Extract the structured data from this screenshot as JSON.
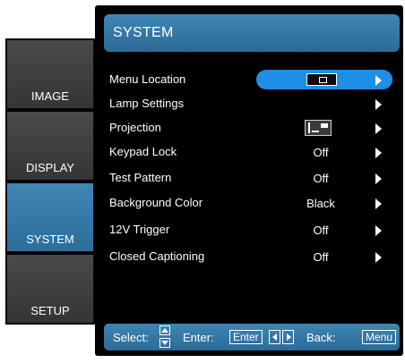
{
  "tabs": [
    {
      "label": "IMAGE",
      "active": false
    },
    {
      "label": "DISPLAY",
      "active": false
    },
    {
      "label": "SYSTEM",
      "active": true
    },
    {
      "label": "SETUP",
      "active": false
    }
  ],
  "title": "SYSTEM",
  "menu": [
    {
      "label": "Menu Location",
      "value": "",
      "icon": "menu-location-icon",
      "selected": true
    },
    {
      "label": "Lamp Settings",
      "value": ""
    },
    {
      "label": "Projection",
      "value": "",
      "icon": "projection-mode-icon"
    },
    {
      "label": "Keypad Lock",
      "value": "Off"
    },
    {
      "label": "Test Pattern",
      "value": "Off"
    },
    {
      "label": "Background Color",
      "value": "Black"
    },
    {
      "label": "12V Trigger",
      "value": "Off"
    },
    {
      "label": "Closed Captioning",
      "value": "Off"
    }
  ],
  "footer": {
    "select_label": "Select:",
    "enter_label": "Enter:",
    "enter_key": "Enter",
    "back_label": "Back:",
    "back_key": "Menu"
  },
  "colors": {
    "accent": "#3f86b4",
    "highlight": "#1e8ee6",
    "panel_bg": "#000000",
    "tab_bg": "#454545"
  }
}
